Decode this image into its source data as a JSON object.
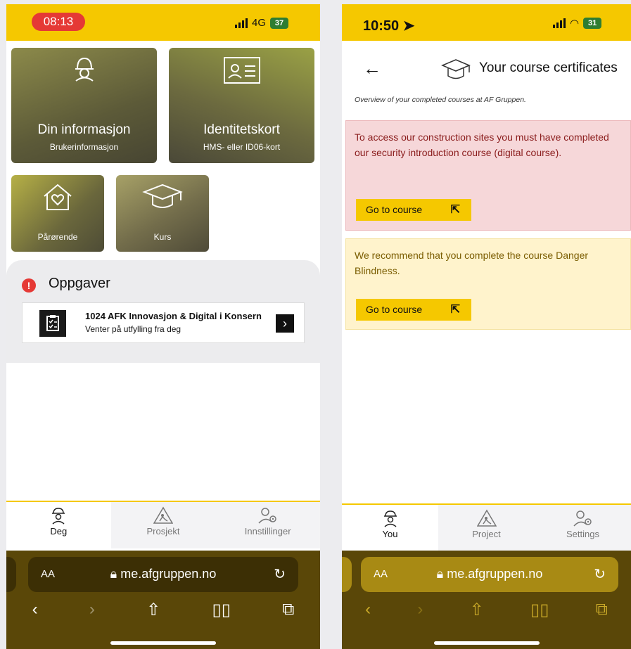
{
  "left": {
    "status": {
      "time": "08:13",
      "network": "4G",
      "battery": "37"
    },
    "tiles": [
      {
        "title": "Din informasjon",
        "subtitle": "Brukerinformasjon"
      },
      {
        "title": "Identitetskort",
        "subtitle": "HMS- eller ID06-kort"
      },
      {
        "label": "Pårørende"
      },
      {
        "label": "Kurs"
      }
    ],
    "tasks": {
      "title": "Oppgaver",
      "items": [
        {
          "title": "1024 AFK Innovasjon & Digital i Konsern",
          "subtitle": "Venter på utfylling fra deg"
        }
      ]
    },
    "nav": {
      "items": [
        "Deg",
        "Prosjekt",
        "Innstillinger"
      ],
      "active": "Deg"
    },
    "browser": {
      "aa": "AA",
      "url": "me.afgruppen.no"
    }
  },
  "right": {
    "status": {
      "time": "10:50",
      "battery": "31"
    },
    "header": {
      "title": "Your course certificates",
      "subtitle": "Overview of your completed courses at AF Gruppen."
    },
    "notices": [
      {
        "text": "To access our construction sites you must have completed our security introduction course (digital course).",
        "button": "Go to course",
        "color": "#f6d7d9"
      },
      {
        "text": "We recommend that you complete the course Danger Blindness.",
        "button": "Go to course",
        "color": "#fff3cc"
      }
    ],
    "nav": {
      "items": [
        "You",
        "Project",
        "Settings"
      ],
      "active": "You"
    },
    "browser": {
      "aa": "AA",
      "url": "me.afgruppen.no"
    }
  },
  "colors": {
    "brand_yellow": "#f5c800",
    "alert_red": "#e53935",
    "safari_bar": "#5a4708"
  }
}
